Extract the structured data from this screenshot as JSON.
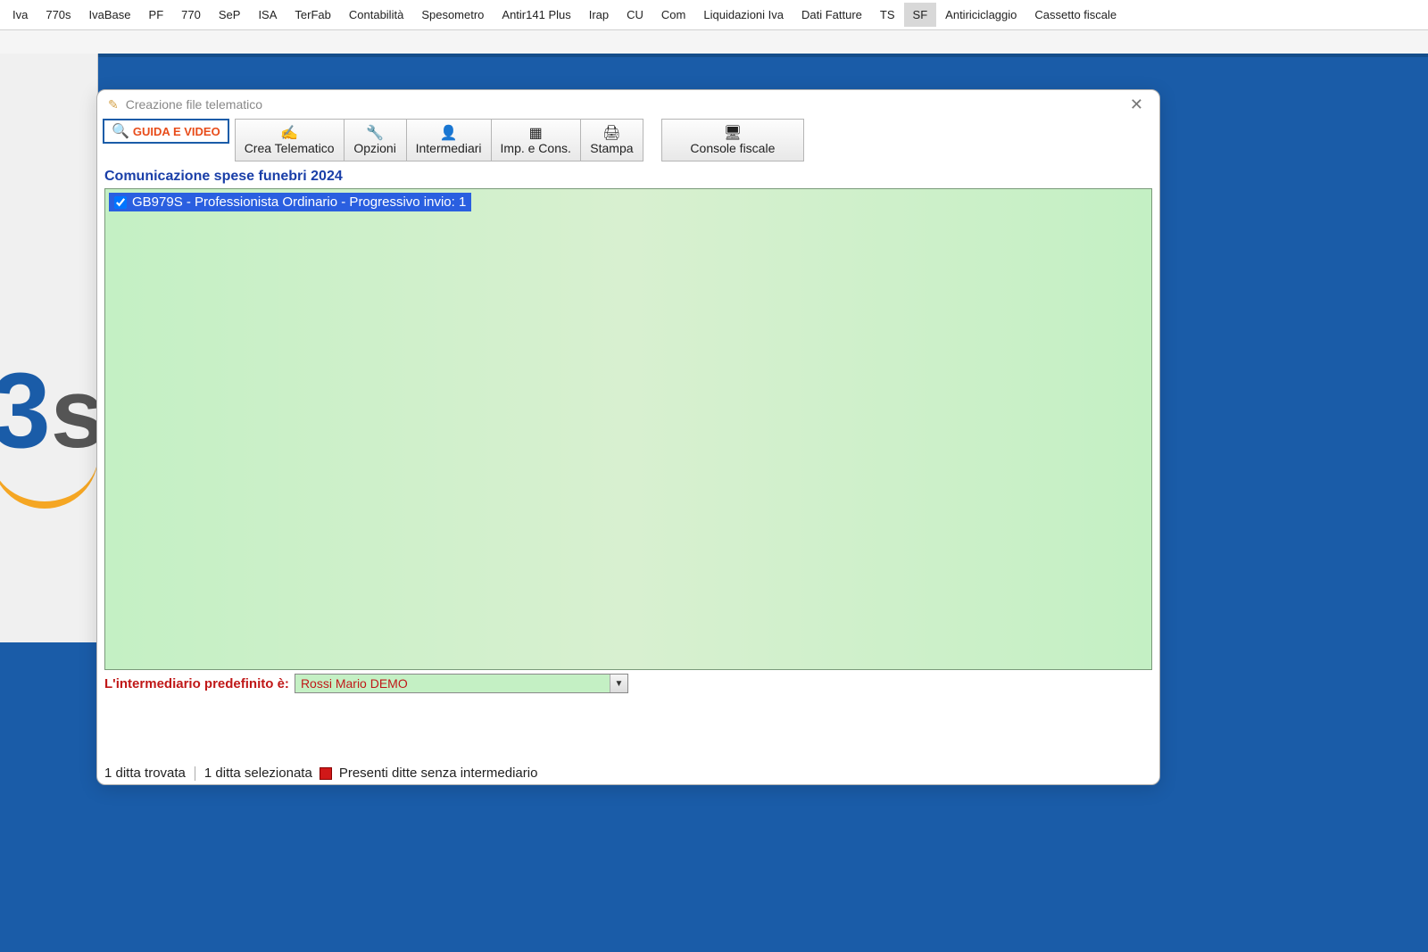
{
  "menu": {
    "items": [
      {
        "label": "Iva",
        "active": false
      },
      {
        "label": "770s",
        "active": false
      },
      {
        "label": "IvaBase",
        "active": false
      },
      {
        "label": "PF",
        "active": false
      },
      {
        "label": "770",
        "active": false
      },
      {
        "label": "SeP",
        "active": false
      },
      {
        "label": "ISA",
        "active": false
      },
      {
        "label": "TerFab",
        "active": false
      },
      {
        "label": "Contabilità",
        "active": false
      },
      {
        "label": "Spesometro",
        "active": false
      },
      {
        "label": "Antir141 Plus",
        "active": false
      },
      {
        "label": "Irap",
        "active": false
      },
      {
        "label": "CU",
        "active": false
      },
      {
        "label": "Com",
        "active": false
      },
      {
        "label": "Liquidazioni Iva",
        "active": false
      },
      {
        "label": "Dati Fatture",
        "active": false
      },
      {
        "label": "TS",
        "active": false
      },
      {
        "label": "SF",
        "active": true
      },
      {
        "label": "Antiriciclaggio",
        "active": false
      },
      {
        "label": "Cassetto fiscale",
        "active": false
      }
    ]
  },
  "dialog": {
    "title": "Creazione file telematico",
    "guide_label": "GUIDA E VIDEO",
    "toolbar": [
      {
        "label": "Crea Telematico",
        "icon": "✍"
      },
      {
        "label": "Opzioni",
        "icon": "🔧"
      },
      {
        "label": "Intermediari",
        "icon": "👤"
      },
      {
        "label": "Imp. e Cons.",
        "icon": "▦"
      },
      {
        "label": "Stampa",
        "icon": "🖨"
      }
    ],
    "console_label": "Console fiscale",
    "console_icon": "🖥",
    "section_title": "Comunicazione spese funebri 2024",
    "list": [
      {
        "checked": true,
        "text": "GB979S - Professionista Ordinario  - Progressivo invio: 1"
      }
    ],
    "intermediary_label": "L'intermediario predefinito è:",
    "intermediary_value": "Rossi Mario DEMO",
    "status": {
      "found": "1 ditta trovata",
      "selected": "1 ditta selezionata",
      "warning": "Presenti ditte senza intermediario"
    }
  }
}
